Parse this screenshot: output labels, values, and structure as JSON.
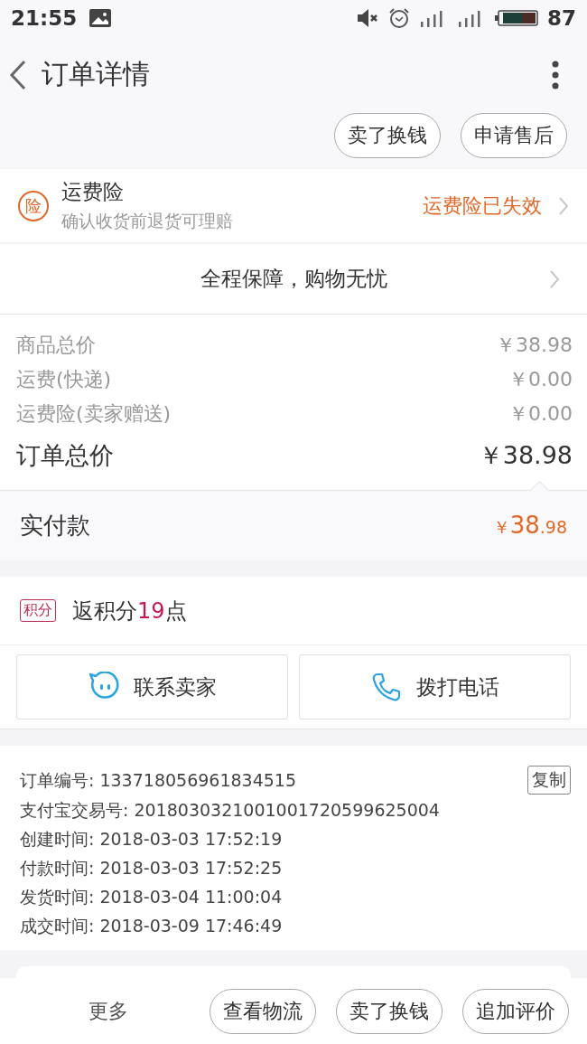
{
  "status_bar": {
    "time": "21:55",
    "battery": "87"
  },
  "header": {
    "title": "订单详情"
  },
  "top_actions": [
    "卖了换钱",
    "申请售后"
  ],
  "insurance": {
    "badge": "险",
    "title": "运费险",
    "subtitle": "确认收货前退货可理赔",
    "status": "运费险已失效"
  },
  "guarantee": {
    "text": "全程保障，购物无忧"
  },
  "prices": [
    {
      "label": "商品总价",
      "value": "￥38.98"
    },
    {
      "label": "运费(快递)",
      "value": "￥0.00"
    },
    {
      "label": "运费险(卖家赠送)",
      "value": "￥0.00"
    }
  ],
  "total": {
    "label": "订单总价",
    "value": "￥38.98"
  },
  "paid": {
    "label": "实付款",
    "symbol": "￥",
    "integer": "38",
    "fraction": ".98"
  },
  "points": {
    "badge": "积分",
    "prefix": "返积分",
    "number": "19",
    "suffix": "点"
  },
  "contact_buttons": [
    {
      "kind": "chat",
      "label": "联系卖家"
    },
    {
      "kind": "phone",
      "label": "拨打电话"
    }
  ],
  "order_info": {
    "copy": "复制",
    "lines": [
      "订单编号: 133718056961834515",
      "支付宝交易号: 2018030321001001720599625004",
      "创建时间: 2018-03-03 17:52:19",
      "付款时间: 2018-03-03 17:52:25",
      "发货时间: 2018-03-04 11:00:04",
      "成交时间: 2018-03-09 17:46:49"
    ]
  },
  "bottom_bar": {
    "more": "更多",
    "buttons": [
      "查看物流",
      "卖了换钱",
      "追加评价"
    ]
  }
}
